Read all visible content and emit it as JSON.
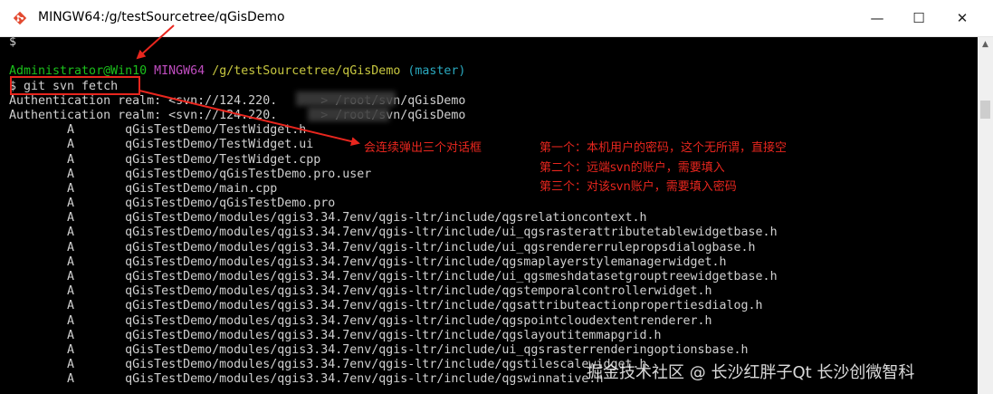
{
  "window": {
    "title": "MINGW64:/g/testSourcetree/qGisDemo",
    "controls": {
      "minimize": "—",
      "maximize": "☐",
      "close": "✕"
    }
  },
  "terminal": {
    "lines": [
      [
        {
          "t": "$",
          "c": "white"
        }
      ],
      [
        {
          "t": "",
          "c": "white"
        }
      ],
      [
        {
          "t": "Administrator@Win10",
          "c": "green"
        },
        {
          "t": " ",
          "c": "white"
        },
        {
          "t": "MINGW64",
          "c": "magenta"
        },
        {
          "t": " ",
          "c": "white"
        },
        {
          "t": "/g/testSourcetree/qGisDemo",
          "c": "yellow"
        },
        {
          "t": " ",
          "c": "white"
        },
        {
          "t": "(master)",
          "c": "cyan"
        }
      ],
      [
        {
          "t": "$ git svn fetch",
          "c": "white"
        }
      ],
      [
        {
          "t": "Authentication realm: <svn://124.220.      > /root/svn/qGisDemo",
          "c": "white"
        }
      ],
      [
        {
          "t": "Authentication realm: <svn://124.220.      > /root/svn/qGisDemo",
          "c": "white"
        }
      ],
      [
        {
          "t": "        A       qGisTestDemo/TestWidget.h",
          "c": "white"
        }
      ],
      [
        {
          "t": "        A       qGisTestDemo/TestWidget.ui",
          "c": "white"
        }
      ],
      [
        {
          "t": "        A       qGisTestDemo/TestWidget.cpp",
          "c": "white"
        }
      ],
      [
        {
          "t": "        A       qGisTestDemo/qGisTestDemo.pro.user",
          "c": "white"
        }
      ],
      [
        {
          "t": "        A       qGisTestDemo/main.cpp",
          "c": "white"
        }
      ],
      [
        {
          "t": "        A       qGisTestDemo/qGisTestDemo.pro",
          "c": "white"
        }
      ],
      [
        {
          "t": "        A       qGisTestDemo/modules/qgis3.34.7env/qgis-ltr/include/qgsrelationcontext.h",
          "c": "white"
        }
      ],
      [
        {
          "t": "        A       qGisTestDemo/modules/qgis3.34.7env/qgis-ltr/include/ui_qgsrasterattributetablewidgetbase.h",
          "c": "white"
        }
      ],
      [
        {
          "t": "        A       qGisTestDemo/modules/qgis3.34.7env/qgis-ltr/include/ui_qgsrendererrulepropsdialogbase.h",
          "c": "white"
        }
      ],
      [
        {
          "t": "        A       qGisTestDemo/modules/qgis3.34.7env/qgis-ltr/include/qgsmaplayerstylemanagerwidget.h",
          "c": "white"
        }
      ],
      [
        {
          "t": "        A       qGisTestDemo/modules/qgis3.34.7env/qgis-ltr/include/ui_qgsmeshdatasetgrouptreewidgetbase.h",
          "c": "white"
        }
      ],
      [
        {
          "t": "        A       qGisTestDemo/modules/qgis3.34.7env/qgis-ltr/include/qgstemporalcontrollerwidget.h",
          "c": "white"
        }
      ],
      [
        {
          "t": "        A       qGisTestDemo/modules/qgis3.34.7env/qgis-ltr/include/qgsattributeactionpropertiesdialog.h",
          "c": "white"
        }
      ],
      [
        {
          "t": "        A       qGisTestDemo/modules/qgis3.34.7env/qgis-ltr/include/qgspointcloudextentrenderer.h",
          "c": "white"
        }
      ],
      [
        {
          "t": "        A       qGisTestDemo/modules/qgis3.34.7env/qgis-ltr/include/qgslayoutitemmapgrid.h",
          "c": "white"
        }
      ],
      [
        {
          "t": "        A       qGisTestDemo/modules/qgis3.34.7env/qgis-ltr/include/ui_qgsrasterrenderingoptionsbase.h",
          "c": "white"
        }
      ],
      [
        {
          "t": "        A       qGisTestDemo/modules/qgis3.34.7env/qgis-ltr/include/qgstilescalewidget.h",
          "c": "white"
        }
      ],
      [
        {
          "t": "        A       qGisTestDemo/modules/qgis3.34.7env/qgis-ltr/include/qgswinnative.h",
          "c": "white"
        }
      ]
    ]
  },
  "annotations": {
    "dialogs_note": "会连续弹出三个对话框",
    "first": "第一个：本机用户的密码，这个无所谓，直接空",
    "second": "第二个：远端svn的账户，需要填入",
    "third": "第三个：对该svn账户，需要填入密码"
  },
  "watermark": "掘金技术社区 @ 长沙红胖子Qt  长沙创微智科",
  "colors": {
    "green": "#1bc11b",
    "magenta": "#c04dc0",
    "yellow": "#c8c840",
    "cyan": "#2aa9bf",
    "white": "#d0d0d0",
    "annotation_red": "#e8261e"
  }
}
